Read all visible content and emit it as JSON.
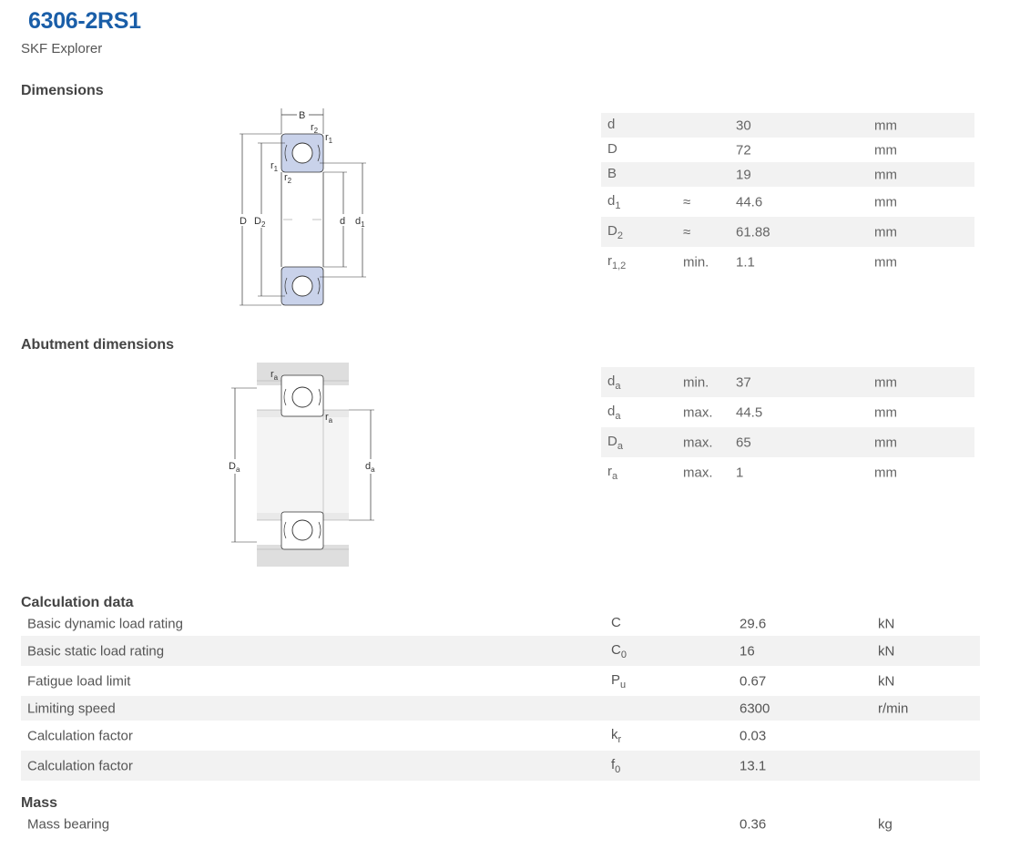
{
  "header": {
    "title": "6306-2RS1",
    "subtitle": "SKF Explorer"
  },
  "sections": {
    "dimensions": "Dimensions",
    "abutment": "Abutment dimensions",
    "calculation": "Calculation data",
    "mass": "Mass"
  },
  "diagram_labels": {
    "B": "B",
    "r": "r",
    "D": "D",
    "d": "d",
    "sub1": "1",
    "sub2": "2",
    "suba": "a"
  },
  "dimensions": [
    {
      "sym": "d",
      "sub": "",
      "qual": "",
      "value": "30",
      "unit": "mm"
    },
    {
      "sym": "D",
      "sub": "",
      "qual": "",
      "value": "72",
      "unit": "mm"
    },
    {
      "sym": "B",
      "sub": "",
      "qual": "",
      "value": "19",
      "unit": "mm"
    },
    {
      "sym": "d",
      "sub": "1",
      "qual": "≈",
      "value": "44.6",
      "unit": "mm"
    },
    {
      "sym": "D",
      "sub": "2",
      "qual": "≈",
      "value": "61.88",
      "unit": "mm"
    },
    {
      "sym": "r",
      "sub": "1,2",
      "qual": "min.",
      "value": "1.1",
      "unit": "mm"
    }
  ],
  "abutment": [
    {
      "sym": "d",
      "sub": "a",
      "qual": "min.",
      "value": "37",
      "unit": "mm"
    },
    {
      "sym": "d",
      "sub": "a",
      "qual": "max.",
      "value": "44.5",
      "unit": "mm"
    },
    {
      "sym": "D",
      "sub": "a",
      "qual": "max.",
      "value": "65",
      "unit": "mm"
    },
    {
      "sym": "r",
      "sub": "a",
      "qual": "max.",
      "value": "1",
      "unit": "mm"
    }
  ],
  "calculation": [
    {
      "label": "Basic dynamic load rating",
      "sym": "C",
      "sub": "",
      "value": "29.6",
      "unit": "kN"
    },
    {
      "label": "Basic static load rating",
      "sym": "C",
      "sub": "0",
      "value": "16",
      "unit": "kN"
    },
    {
      "label": "Fatigue load limit",
      "sym": "P",
      "sub": "u",
      "value": "0.67",
      "unit": "kN"
    },
    {
      "label": "Limiting speed",
      "sym": "",
      "sub": "",
      "value": "6300",
      "unit": "r/min"
    },
    {
      "label": "Calculation factor",
      "sym": "k",
      "sub": "r",
      "value": "0.03",
      "unit": ""
    },
    {
      "label": "Calculation factor",
      "sym": "f",
      "sub": "0",
      "value": "13.1",
      "unit": ""
    }
  ],
  "mass": [
    {
      "label": "Mass bearing",
      "sym": "",
      "sub": "",
      "value": "0.36",
      "unit": "kg"
    }
  ]
}
